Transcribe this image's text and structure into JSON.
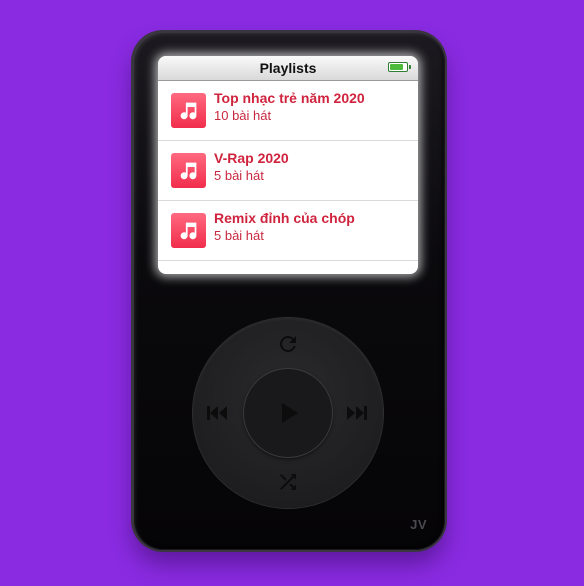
{
  "screen": {
    "title": "Playlists",
    "battery_level": 0.85,
    "playlists": [
      {
        "name": "Top nhạc trẻ năm 2020",
        "count": "10 bài hát",
        "icon": "music-note-icon"
      },
      {
        "name": "V-Rap 2020",
        "count": "5 bài hát",
        "icon": "music-note-icon"
      },
      {
        "name": "Remix đỉnh của chóp",
        "count": "5 bài hát",
        "icon": "music-note-icon"
      }
    ]
  },
  "wheel": {
    "top_icon": "repeat-icon",
    "left_icon": "previous-icon",
    "right_icon": "next-icon",
    "bottom_icon": "shuffle-icon",
    "center_icon": "play-icon"
  },
  "brand": "JV",
  "colors": {
    "background": "#8a2be2",
    "accent": "#d0243e",
    "thumb": "#f12d4c"
  }
}
